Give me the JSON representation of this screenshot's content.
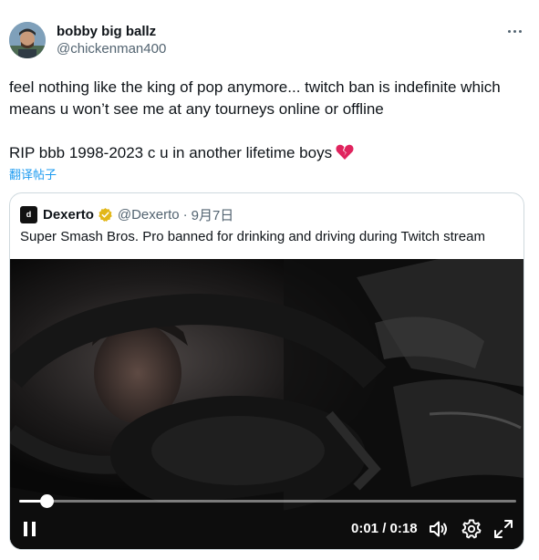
{
  "author": {
    "display_name": "bobby big ballz",
    "handle": "@chickenman400",
    "avatar_icon": "profile-photo"
  },
  "tweet": {
    "line1": "feel nothing like the king of pop anymore... twitch ban is indefinite which",
    "line2": "means u won’t see me at any tourneys online or offline",
    "line3": "RIP bbb 1998-2023 c u in another lifetime boys",
    "emoji": "broken-heart-icon",
    "translate_label": "翻译帖子"
  },
  "quote": {
    "name": "Dexerto",
    "logo_text": "d",
    "verified_badge": "gold-verified-icon",
    "handle": "@Dexerto",
    "separator": "·",
    "date": "9月7日",
    "text": "Super Smash Bros. Pro banned for drinking and driving during Twitch stream"
  },
  "video": {
    "current_time": "0:01",
    "duration": "0:18",
    "time_display": "0:01 / 0:18",
    "progress_fraction": 0.055,
    "state": "playing"
  },
  "colors": {
    "text_primary": "#0f1419",
    "text_secondary": "#536471",
    "link": "#1d9bf0",
    "border": "#cfd9de",
    "verified_gold": "#e2b719",
    "heart_red": "#e0245e"
  }
}
